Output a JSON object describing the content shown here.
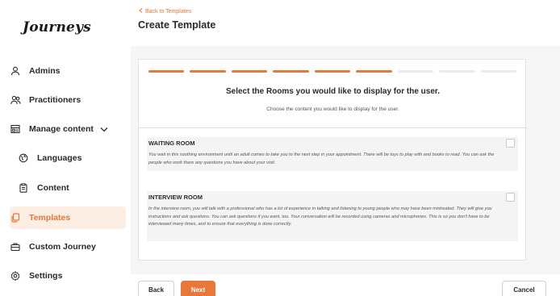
{
  "app": {
    "logo": "Journeys"
  },
  "sidebar": {
    "items": [
      {
        "label": "Admins",
        "icon": "user-icon"
      },
      {
        "label": "Practitioners",
        "icon": "users-icon"
      },
      {
        "label": "Manage content",
        "icon": "content-icon"
      },
      {
        "label": "Languages",
        "icon": "globe-icon"
      },
      {
        "label": "Content",
        "icon": "clipboard-icon"
      },
      {
        "label": "Templates",
        "icon": "copy-icon"
      },
      {
        "label": "Custom Journey",
        "icon": "briefcase-icon"
      },
      {
        "label": "Settings",
        "icon": "gear-icon"
      }
    ],
    "active": "Templates"
  },
  "header": {
    "back_label": "Back to Templates",
    "title": "Create Template"
  },
  "wizard": {
    "steps_total": 9,
    "steps_completed": 6,
    "heading": "Select the Rooms you would like to display for the user.",
    "subheading": "Choose the content you would like to display for the user.",
    "rooms": [
      {
        "title": "WAITING ROOM",
        "description": "You wait in this soothing environment until an adult comes to take you to the next step in your appointment. There will be toys to play with and books to read. You can ask the people who work there any questions you have about your visit.",
        "checked": false
      },
      {
        "title": "INTERVIEW ROOM",
        "description": "In the interview room, you will talk with a professional who has a lot of experience in talking and listening to young people who may have been mistreated. They will give you instructions and ask questions. You can ask questions if you want, too. Your conversation will be recorded using cameras and microphones. This is so you don't have to be interviewed many times, and to ensure that everything is done correctly.",
        "checked": false
      }
    ]
  },
  "footer": {
    "back_label": "Back",
    "next_label": "Next",
    "cancel_label": "Cancel"
  },
  "colors": {
    "accent": "#e8773a",
    "active_bg": "#fdeee4"
  }
}
